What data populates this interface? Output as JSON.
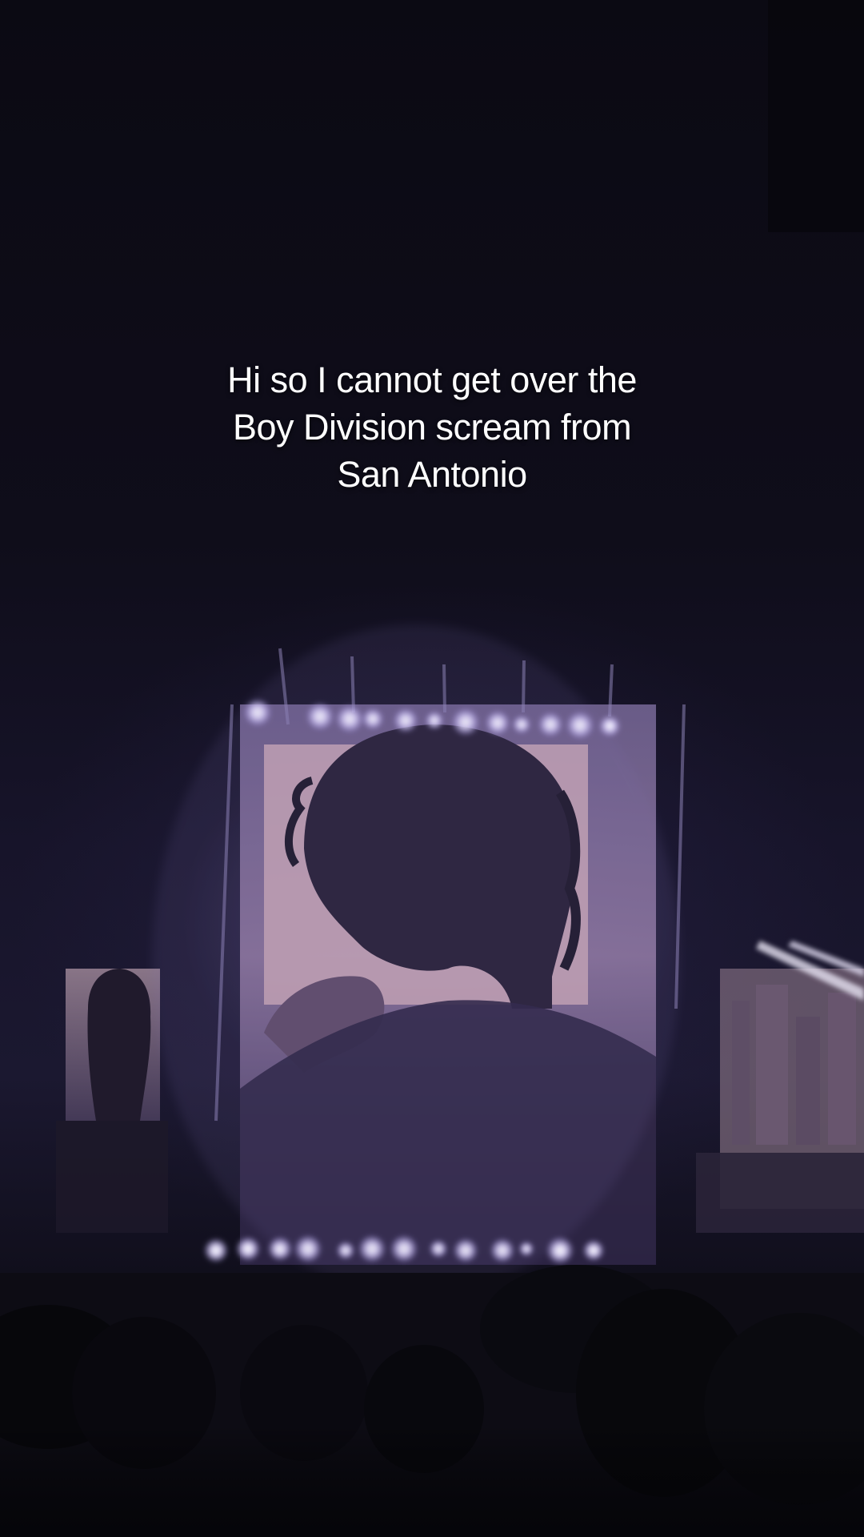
{
  "caption": {
    "lines": [
      "Hi so I cannot get over the",
      "Boy Division scream from",
      "San Antonio"
    ]
  },
  "scene": {
    "subject": "concert-stage-screen",
    "stage_light_color": "#e9e3ff",
    "screen_tint": "#8b7aa8",
    "background_color": "#0b0a14"
  }
}
